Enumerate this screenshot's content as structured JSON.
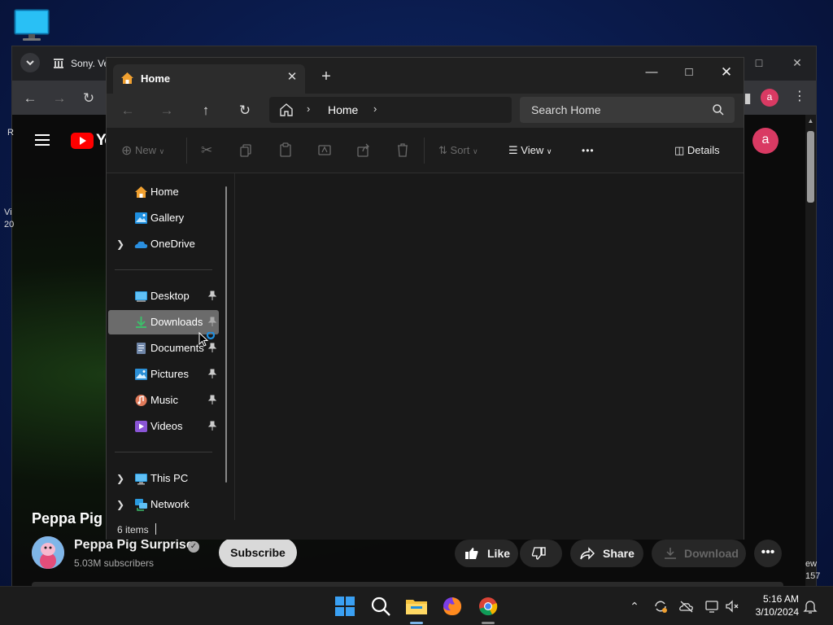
{
  "desktop": {
    "icon": "monitor-icon"
  },
  "chrome": {
    "tab_label": "Sony. Ve",
    "profile_letter": "a",
    "side_left_1": "R",
    "side_left_2": "Vi",
    "side_left_3": "20",
    "side_right_1": "ew",
    "side_right_2": "157"
  },
  "youtube": {
    "logo_text": "Yo",
    "avatar_letter": "a",
    "video_title": "Peppa Pig",
    "channel_name": "Peppa Pig Surprise",
    "subscribers": "5.03M subscribers",
    "subscribe_label": "Subscribe",
    "like_label": "Like",
    "share_label": "Share",
    "download_label": "Download",
    "more_label": "•••"
  },
  "explorer": {
    "tab_title": "Home",
    "address": {
      "segments": [
        "Home"
      ]
    },
    "search_placeholder": "Search Home",
    "commands": {
      "new_label": "New",
      "sort_label": "Sort",
      "view_label": "View",
      "more_label": "•••",
      "details_label": "Details"
    },
    "nav": {
      "quick": [
        {
          "label": "Home",
          "icon": "home-icon"
        },
        {
          "label": "Gallery",
          "icon": "gallery-icon"
        },
        {
          "label": "OneDrive",
          "icon": "onedrive-icon"
        }
      ],
      "pinned": [
        {
          "label": "Desktop",
          "icon": "desktop-folder-icon"
        },
        {
          "label": "Downloads",
          "icon": "downloads-folder-icon",
          "selected": true
        },
        {
          "label": "Documents",
          "icon": "documents-folder-icon"
        },
        {
          "label": "Pictures",
          "icon": "pictures-folder-icon"
        },
        {
          "label": "Music",
          "icon": "music-folder-icon"
        },
        {
          "label": "Videos",
          "icon": "videos-folder-icon"
        }
      ],
      "system": [
        {
          "label": "This PC",
          "icon": "this-pc-icon"
        },
        {
          "label": "Network",
          "icon": "network-icon"
        }
      ]
    },
    "status_text": "6 items"
  },
  "taskbar": {
    "apps": [
      "start-icon",
      "search-icon",
      "file-explorer-icon",
      "firefox-icon",
      "chrome-icon"
    ],
    "time": "5:16 AM",
    "date": "3/10/2024"
  },
  "colors": {
    "accent": "#0078d4",
    "youtube_red": "#ff0000",
    "profile_pink": "#d93a63"
  }
}
